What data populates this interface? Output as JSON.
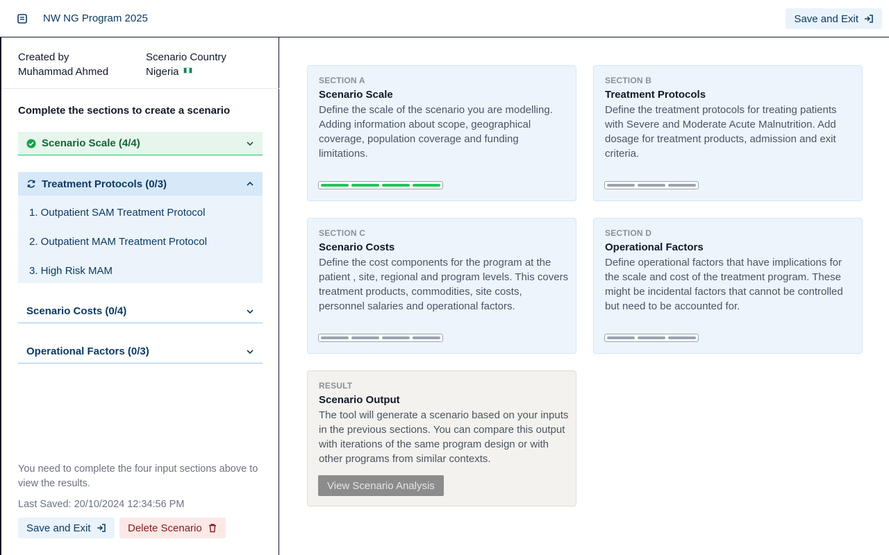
{
  "header": {
    "title": "NW NG Program 2025",
    "save_exit_label": "Save and Exit"
  },
  "sidebar": {
    "created_by_label": "Created by",
    "created_by_value": "Muhammad Ahmed",
    "country_label": "Scenario Country",
    "country_value": "Nigeria",
    "instructions": "Complete the sections to create a scenario",
    "sections": [
      {
        "label": "Scenario Scale (4/4)",
        "status": "complete",
        "expanded": false
      },
      {
        "label": "Treatment Protocols (0/3)",
        "status": "in-progress",
        "expanded": true,
        "items": [
          "1. Outpatient SAM Treatment Protocol",
          "2. Outpatient MAM Treatment Protocol",
          "3. High Risk MAM"
        ]
      },
      {
        "label": "Scenario Costs (0/4)",
        "status": "pending",
        "expanded": false
      },
      {
        "label": "Operational Factors (0/3)",
        "status": "pending",
        "expanded": false
      }
    ],
    "note": "You need to complete the four input sections above to view the results.",
    "last_saved": "Last Saved: 20/10/2024 12:34:56 PM",
    "save_exit_label": "Save and Exit",
    "delete_label": "Delete Scenario"
  },
  "cards": {
    "a": {
      "label": "SECTION A",
      "title": "Scenario Scale",
      "description": "Define the scale of the scenario you are modelling. Adding information about scope, geographical coverage, population coverage and funding limitations.",
      "progress_done": 4,
      "progress_total": 4
    },
    "b": {
      "label": "SECTION B",
      "title": "Treatment Protocols",
      "description": "Define the treatment protocols for treating patients with Severe and Moderate Acute Malnutrition. Add dosage for treatment products, admission and exit criteria.",
      "progress_done": 0,
      "progress_total": 3
    },
    "c": {
      "label": "SECTION C",
      "title": "Scenario Costs",
      "description": "Define the cost components for the program at the patient , site, regional and program levels. This covers treatment products, commodities, site costs, personnel salaries and operational factors.",
      "progress_done": 0,
      "progress_total": 4
    },
    "d": {
      "label": "SECTION D",
      "title": "Operational Factors",
      "description": "Define operational factors that have implications for the scale and cost of the treatment program. These might be incidental factors that cannot be controlled but need to be accounted for.",
      "progress_done": 0,
      "progress_total": 3
    },
    "result": {
      "label": "RESULT",
      "title": "Scenario Output",
      "description": "The tool will generate a scenario based on your inputs in the previous sections. You can compare this output with iterations of the same program design or with other programs from similar contexts.",
      "button_label": "View Scenario Analysis"
    }
  },
  "colors": {
    "brand": "#0b3a63",
    "complete": "#22c55e",
    "pending_bar": "#9ca3af",
    "danger": "#7f1d1d"
  }
}
